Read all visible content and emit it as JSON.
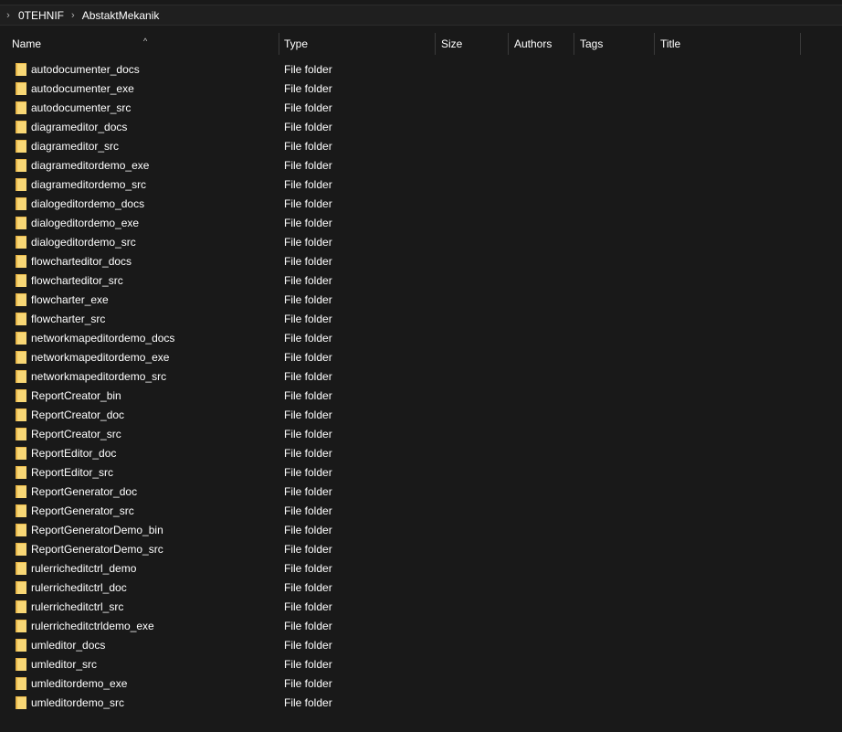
{
  "breadcrumb": {
    "items": [
      "0TEHNIF",
      "AbstaktMekanik"
    ]
  },
  "columns": [
    "Name",
    "Type",
    "Size",
    "Authors",
    "Tags",
    "Title"
  ],
  "files": [
    {
      "name": "autodocumenter_docs",
      "type": "File folder"
    },
    {
      "name": "autodocumenter_exe",
      "type": "File folder"
    },
    {
      "name": "autodocumenter_src",
      "type": "File folder"
    },
    {
      "name": "diagrameditor_docs",
      "type": "File folder"
    },
    {
      "name": "diagrameditor_src",
      "type": "File folder"
    },
    {
      "name": "diagrameditordemo_exe",
      "type": "File folder"
    },
    {
      "name": "diagrameditordemo_src",
      "type": "File folder"
    },
    {
      "name": "dialogeditordemo_docs",
      "type": "File folder"
    },
    {
      "name": "dialogeditordemo_exe",
      "type": "File folder"
    },
    {
      "name": "dialogeditordemo_src",
      "type": "File folder"
    },
    {
      "name": "flowcharteditor_docs",
      "type": "File folder"
    },
    {
      "name": "flowcharteditor_src",
      "type": "File folder"
    },
    {
      "name": "flowcharter_exe",
      "type": "File folder"
    },
    {
      "name": "flowcharter_src",
      "type": "File folder"
    },
    {
      "name": "networkmapeditordemo_docs",
      "type": "File folder"
    },
    {
      "name": "networkmapeditordemo_exe",
      "type": "File folder"
    },
    {
      "name": "networkmapeditordemo_src",
      "type": "File folder"
    },
    {
      "name": "ReportCreator_bin",
      "type": "File folder"
    },
    {
      "name": "ReportCreator_doc",
      "type": "File folder"
    },
    {
      "name": "ReportCreator_src",
      "type": "File folder"
    },
    {
      "name": "ReportEditor_doc",
      "type": "File folder"
    },
    {
      "name": "ReportEditor_src",
      "type": "File folder"
    },
    {
      "name": "ReportGenerator_doc",
      "type": "File folder"
    },
    {
      "name": "ReportGenerator_src",
      "type": "File folder"
    },
    {
      "name": "ReportGeneratorDemo_bin",
      "type": "File folder"
    },
    {
      "name": "ReportGeneratorDemo_src",
      "type": "File folder"
    },
    {
      "name": "rulerricheditctrl_demo",
      "type": "File folder"
    },
    {
      "name": "rulerricheditctrl_doc",
      "type": "File folder"
    },
    {
      "name": "rulerricheditctrl_src",
      "type": "File folder"
    },
    {
      "name": "rulerricheditctrldemo_exe",
      "type": "File folder"
    },
    {
      "name": "umleditor_docs",
      "type": "File folder"
    },
    {
      "name": "umleditor_src",
      "type": "File folder"
    },
    {
      "name": "umleditordemo_exe",
      "type": "File folder"
    },
    {
      "name": "umleditordemo_src",
      "type": "File folder"
    }
  ],
  "icons": {
    "breadcrumb_separator": "chevron-right-icon",
    "sort_indicator": "chevron-up-icon",
    "folder": "folder-icon"
  },
  "colors": {
    "background": "#191919",
    "folder": "#f8d775",
    "text": "#ffffff"
  }
}
